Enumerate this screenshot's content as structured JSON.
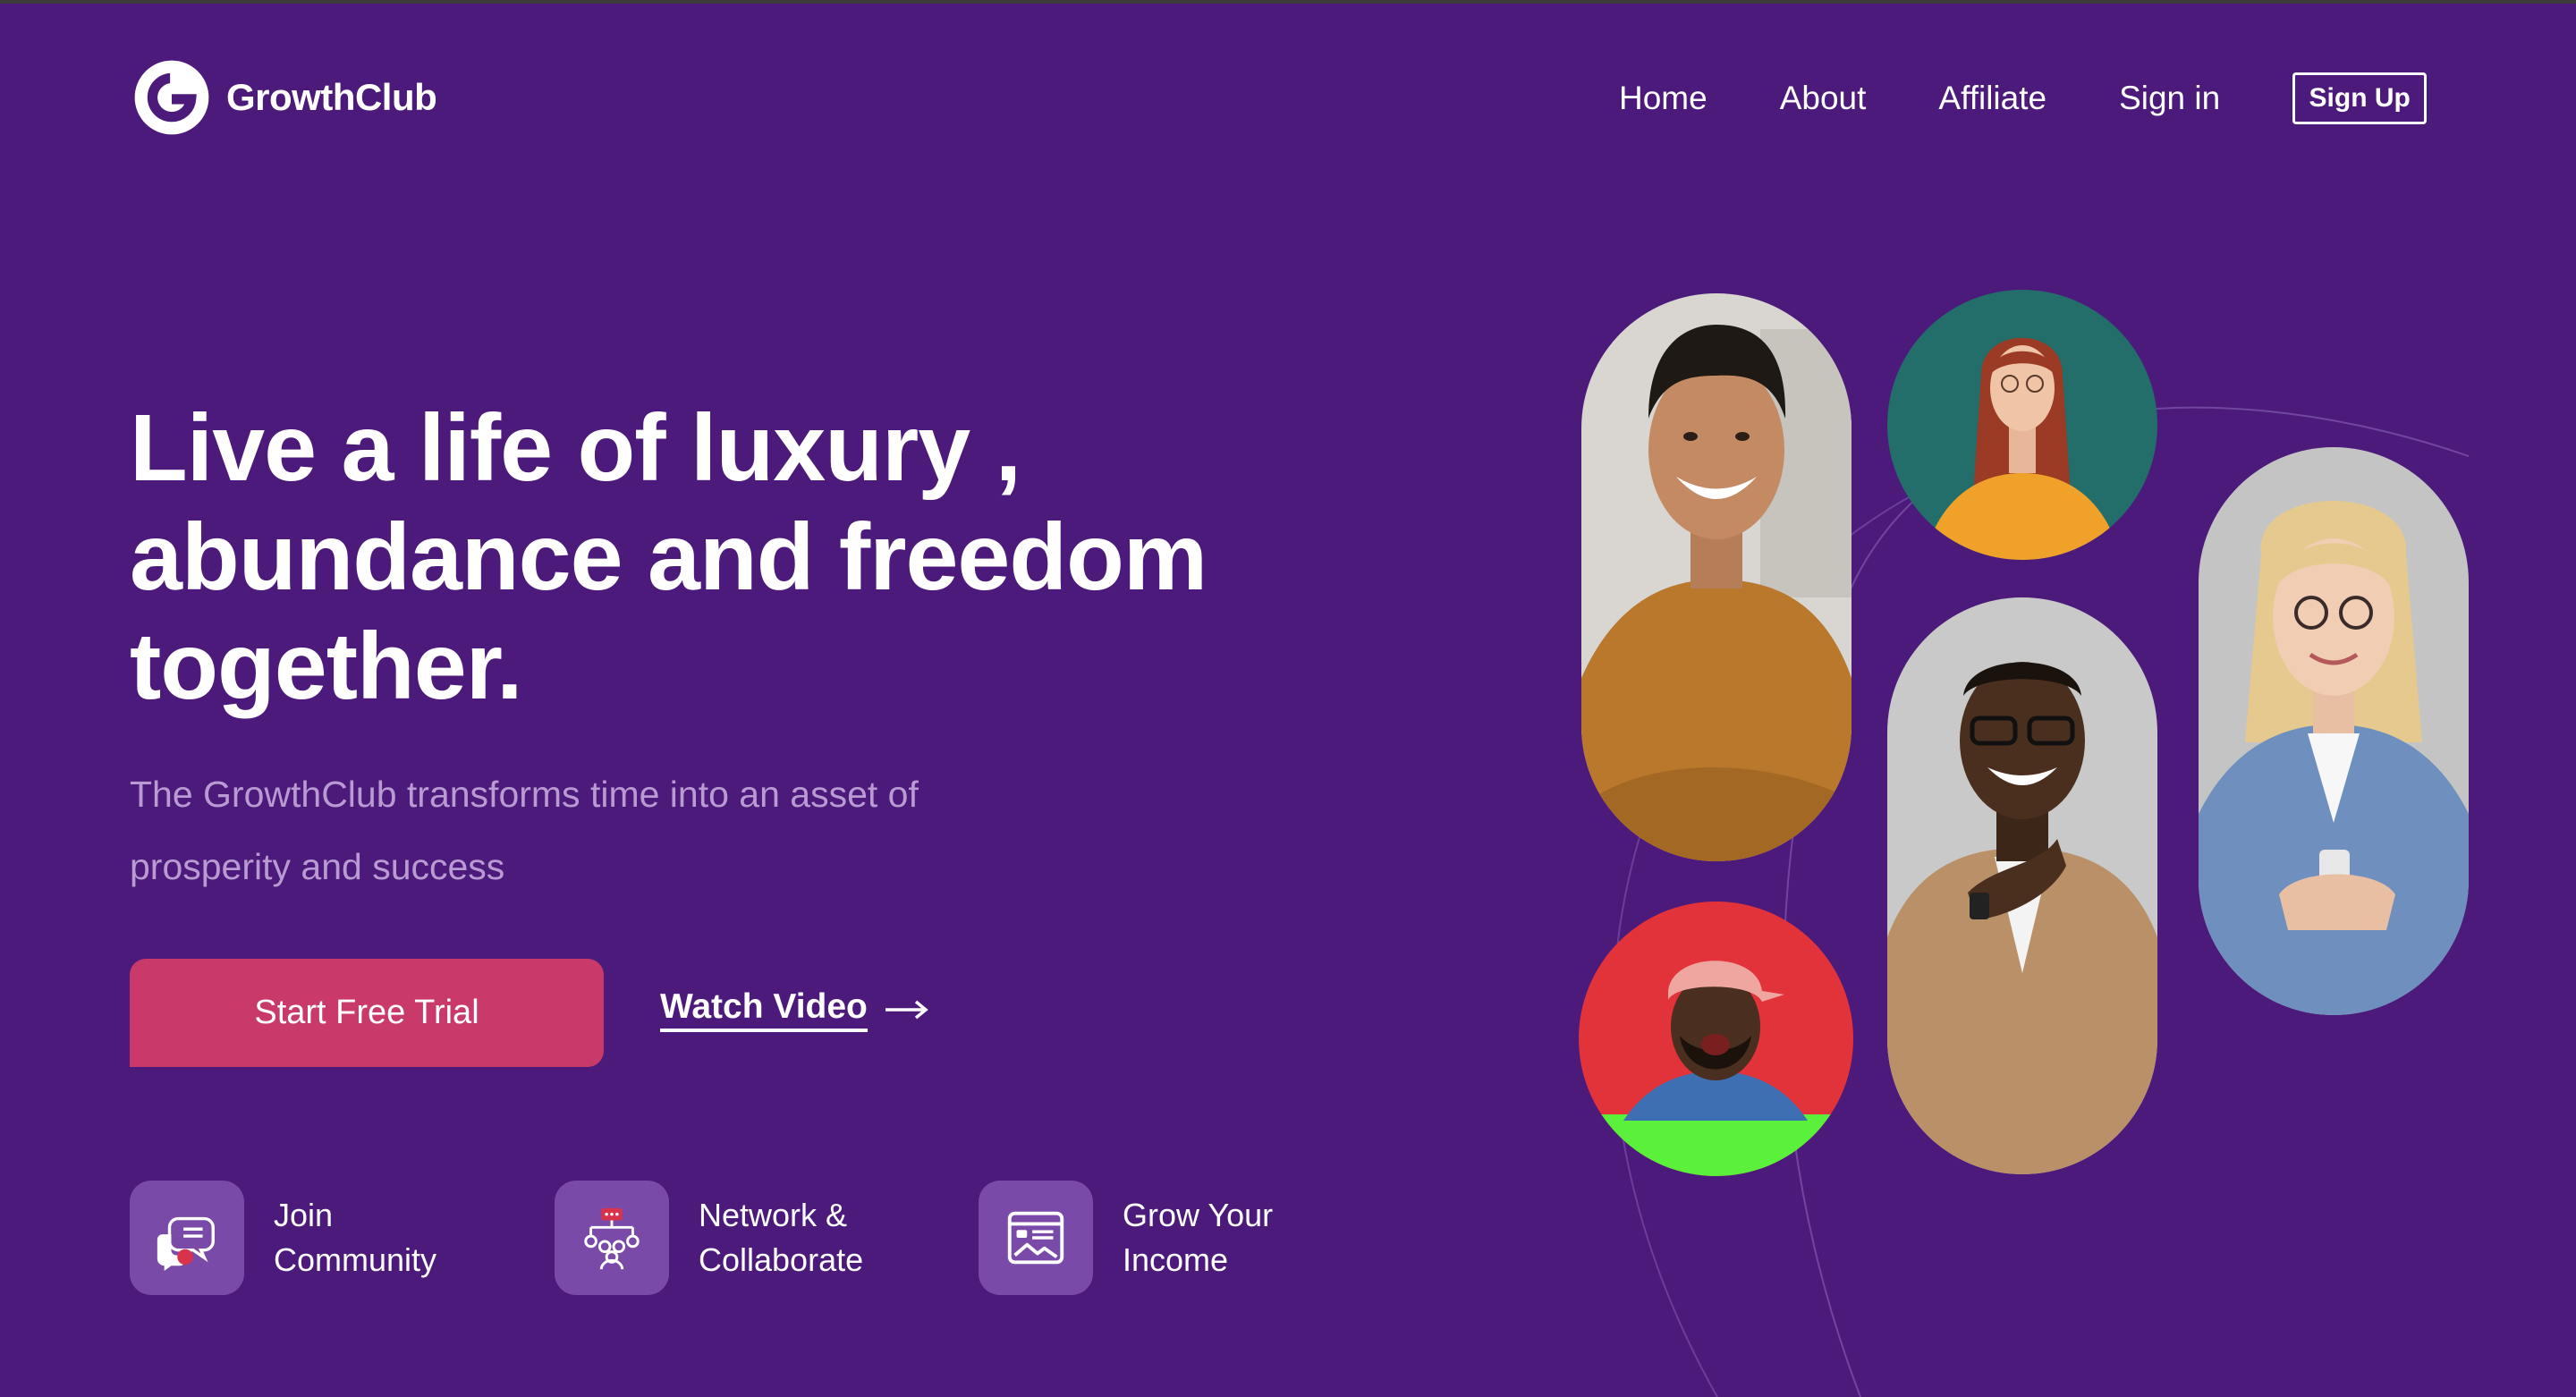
{
  "brand": {
    "name": "GrowthClub",
    "logo_icon": "growthclub-g-logo-icon"
  },
  "nav": {
    "links": [
      {
        "label": "Home"
      },
      {
        "label": "About"
      },
      {
        "label": "Affiliate"
      },
      {
        "label": "Sign in"
      }
    ],
    "signup_label": "Sign Up"
  },
  "hero": {
    "headline_lines": [
      "Live a life of luxury ,",
      "abundance and freedom",
      "together."
    ],
    "subtext_lines": [
      "The GrowthClub transforms time into an asset of",
      "prosperity and success"
    ],
    "primary_cta": "Start Free Trial",
    "secondary_cta": "Watch Video",
    "secondary_cta_icon": "arrow-right-icon"
  },
  "features": [
    {
      "lines": [
        "Join",
        "Community"
      ],
      "icon": "chat-bubbles-icon"
    },
    {
      "lines": [
        "Network &",
        "Collaborate"
      ],
      "icon": "people-network-icon"
    },
    {
      "lines": [
        "Grow Your",
        "Income"
      ],
      "icon": "browser-chart-icon"
    }
  ],
  "colors": {
    "background": "#4b1a7b",
    "primary_button": "#c93a6a",
    "subtext": "#b99ad3",
    "feature_tile": "#7a4aa8"
  },
  "photos": [
    {
      "subject": "smiling man in mustard polo",
      "bg": "#d9d6d2"
    },
    {
      "subject": "red-haired woman with glasses",
      "bg": "#236e6b"
    },
    {
      "subject": "smiling man in beige blazer",
      "bg": "#c9c9c9"
    },
    {
      "subject": "blonde woman in blue blazer with phone",
      "bg": "#c4c4c4"
    },
    {
      "subject": "laughing man in pink cap",
      "bg": "#e2323a"
    }
  ]
}
